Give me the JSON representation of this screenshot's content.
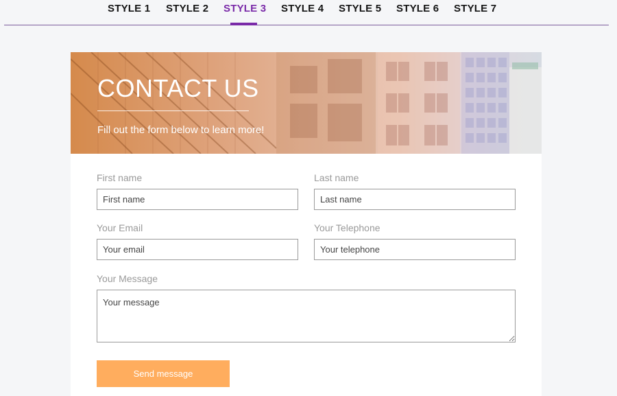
{
  "tabs": [
    {
      "label": "STYLE 1",
      "active": false
    },
    {
      "label": "STYLE 2",
      "active": false
    },
    {
      "label": "STYLE 3",
      "active": true
    },
    {
      "label": "STYLE 4",
      "active": false
    },
    {
      "label": "STYLE 5",
      "active": false
    },
    {
      "label": "STYLE 6",
      "active": false
    },
    {
      "label": "STYLE 7",
      "active": false
    }
  ],
  "colors": {
    "accent": "#7a2aa8",
    "button": "#ffad5e"
  },
  "hero": {
    "title": "CONTACT US",
    "subtitle": "Fill out the form below to learn more!"
  },
  "form": {
    "first_name": {
      "label": "First name",
      "placeholder": "First name",
      "value": ""
    },
    "last_name": {
      "label": "Last name",
      "placeholder": "Last name",
      "value": ""
    },
    "email": {
      "label": "Your Email",
      "placeholder": "Your email",
      "value": ""
    },
    "telephone": {
      "label": "Your Telephone",
      "placeholder": "Your telephone",
      "value": ""
    },
    "message": {
      "label": "Your Message",
      "placeholder": "Your message",
      "value": ""
    },
    "submit_label": "Send message"
  }
}
